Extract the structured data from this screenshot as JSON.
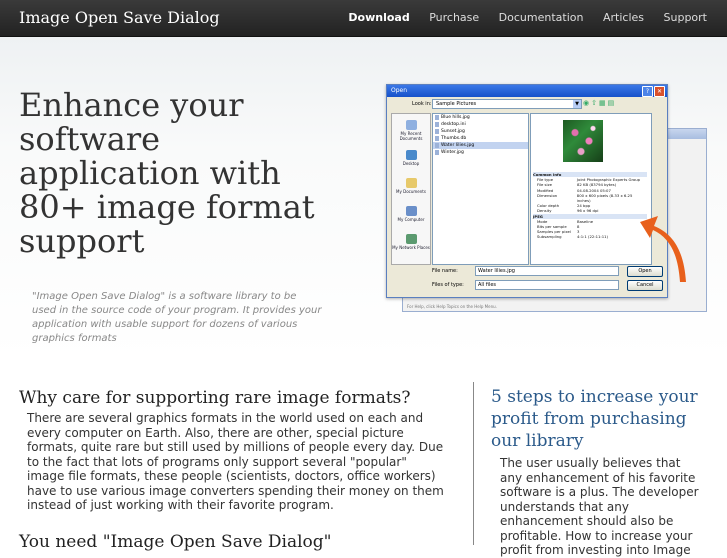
{
  "header": {
    "brand": "Image Open Save Dialog",
    "nav": [
      {
        "label": "Download",
        "active": true
      },
      {
        "label": "Purchase"
      },
      {
        "label": "Documentation"
      },
      {
        "label": "Articles"
      },
      {
        "label": "Support"
      }
    ]
  },
  "hero": {
    "headline": "Enhance your software application with 80+ image format support",
    "intro": "\"Image Open Save Dialog\" is a software library to be used in the source code of your program. It provides your application with usable support for dozens of various graphics formats"
  },
  "dialog": {
    "title": "Open",
    "look_in_label": "Look in:",
    "look_in_value": "Sample Pictures",
    "places": [
      "My Recent Documents",
      "Desktop",
      "My Documents",
      "My Computer",
      "My Network Places"
    ],
    "files": [
      {
        "name": "Blue hills.jpg"
      },
      {
        "name": "desktop.ini"
      },
      {
        "name": "Sunset.jpg"
      },
      {
        "name": "Thumbs.db"
      },
      {
        "name": "Water lilies.jpg",
        "selected": true
      },
      {
        "name": "Winter.jpg"
      }
    ],
    "info": [
      {
        "section": "Common Info"
      },
      {
        "k": "File type",
        "v": "Joint Photographic Experts Group"
      },
      {
        "k": "File size",
        "v": "82 KB (83794 bytes)"
      },
      {
        "k": "Modified",
        "v": "04.08.2004 05:07"
      },
      {
        "k": "Dimension",
        "v": "800 x 600 pixels (8.33 x 6.25 inches)"
      },
      {
        "k": "Color depth",
        "v": "24 bpp"
      },
      {
        "k": "Density",
        "v": "96 x 96 dpi"
      },
      {
        "section": "JPEG"
      },
      {
        "k": "Mode",
        "v": "Baseline"
      },
      {
        "k": "Bits per sample",
        "v": "8"
      },
      {
        "k": "Samples per pixel",
        "v": "3"
      },
      {
        "k": "Subsampling",
        "v": "4:1:1 (22:11:11)"
      }
    ],
    "file_name_label": "File name:",
    "file_name_value": "Water lilies.jpg",
    "file_type_label": "Files of type:",
    "file_type_value": "All files",
    "open_label": "Open",
    "cancel_label": "Cancel",
    "status_hint": "For Help, click Help Topics on the Help Menu."
  },
  "section1": {
    "title": "Why care for supporting rare image formats?",
    "body": "There are several graphics formats in the world used on each and every computer on Earth. Also, there are other, special picture formats, quite rare but still used by millions of people every day. Due to the fact that lots of programs only support several \"popular\" image file formats, these people (scientists, doctors, office workers) have to use various image converters spending their money on them instead of just working with their favorite program."
  },
  "section2": {
    "title": "You need \"Image Open Save Dialog\""
  },
  "sidebar": {
    "title": "5 steps to increase your profit from purchasing our library",
    "body": "The user usually believes that any enhancement of his favorite software is a plus. The developer understands that any enhancement should also be profitable. How to increase your profit from investing into Image"
  },
  "colors": {
    "topbar": "#2c2c2c",
    "sidebar_title": "#2b5a8a",
    "arrow": "#e8601c",
    "xp_blue": "#1651c9"
  }
}
